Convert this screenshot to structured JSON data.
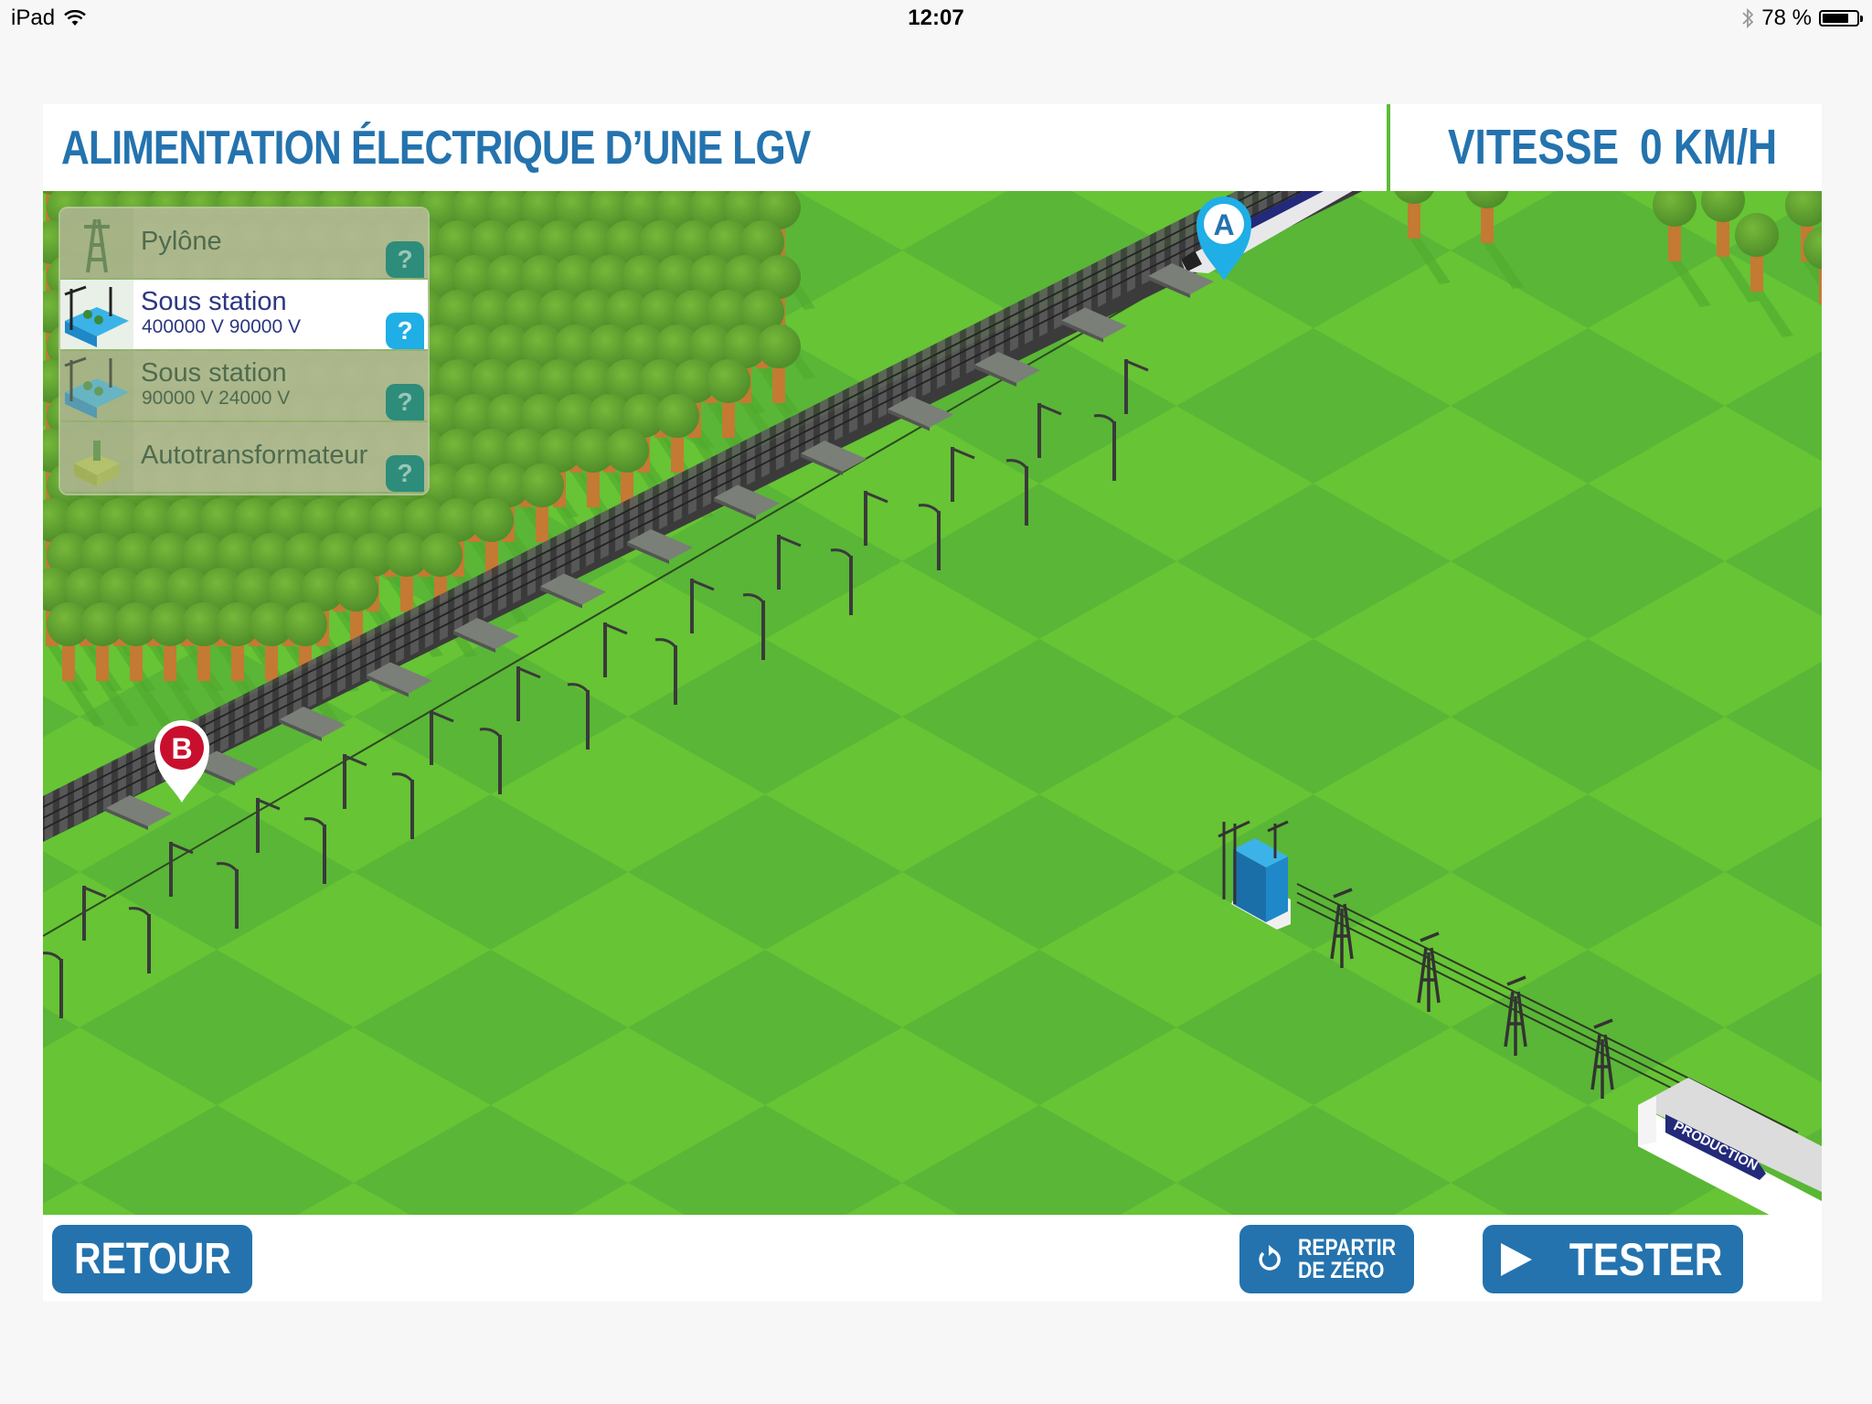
{
  "status_bar": {
    "device": "iPad",
    "time": "12:07",
    "battery_percent_label": "78 %",
    "battery_level": 0.78,
    "icons": [
      "wifi-icon",
      "bluetooth-icon",
      "battery-icon"
    ]
  },
  "header": {
    "title": "ALIMENTATION ÉLECTRIQUE D’UNE LGV",
    "speed_label": "VITESSE",
    "speed_value": "0 KM/H"
  },
  "menu": {
    "items": [
      {
        "label": "Pylône",
        "sub": "",
        "selected": false,
        "icon": "pylon-icon",
        "help": "?"
      },
      {
        "label": "Sous station",
        "sub": "400000 V  90000 V",
        "selected": true,
        "icon": "substation-icon",
        "help": "?"
      },
      {
        "label": "Sous station",
        "sub": "90000 V  24000 V",
        "selected": false,
        "icon": "substation-icon",
        "help": "?"
      },
      {
        "label": "Autotransformateur",
        "sub": "",
        "selected": false,
        "icon": "autotransformer-icon",
        "help": "?"
      }
    ]
  },
  "map": {
    "marker_a": "A",
    "marker_b": "B",
    "production_label": "PRODUCTION",
    "colors": {
      "grass_light": "#66C435",
      "grass_dark": "#5AB636",
      "marker_a": "#1FAEE6",
      "marker_b": "#C8102E",
      "substation": "#1E88C8"
    }
  },
  "footer": {
    "back_label": "RETOUR",
    "reset_label_line1": "REPARTIR",
    "reset_label_line2": "DE ZÉRO",
    "test_label": "TESTER"
  },
  "colors": {
    "primary": "#2473AE",
    "accent_green": "#5DBB3C"
  }
}
